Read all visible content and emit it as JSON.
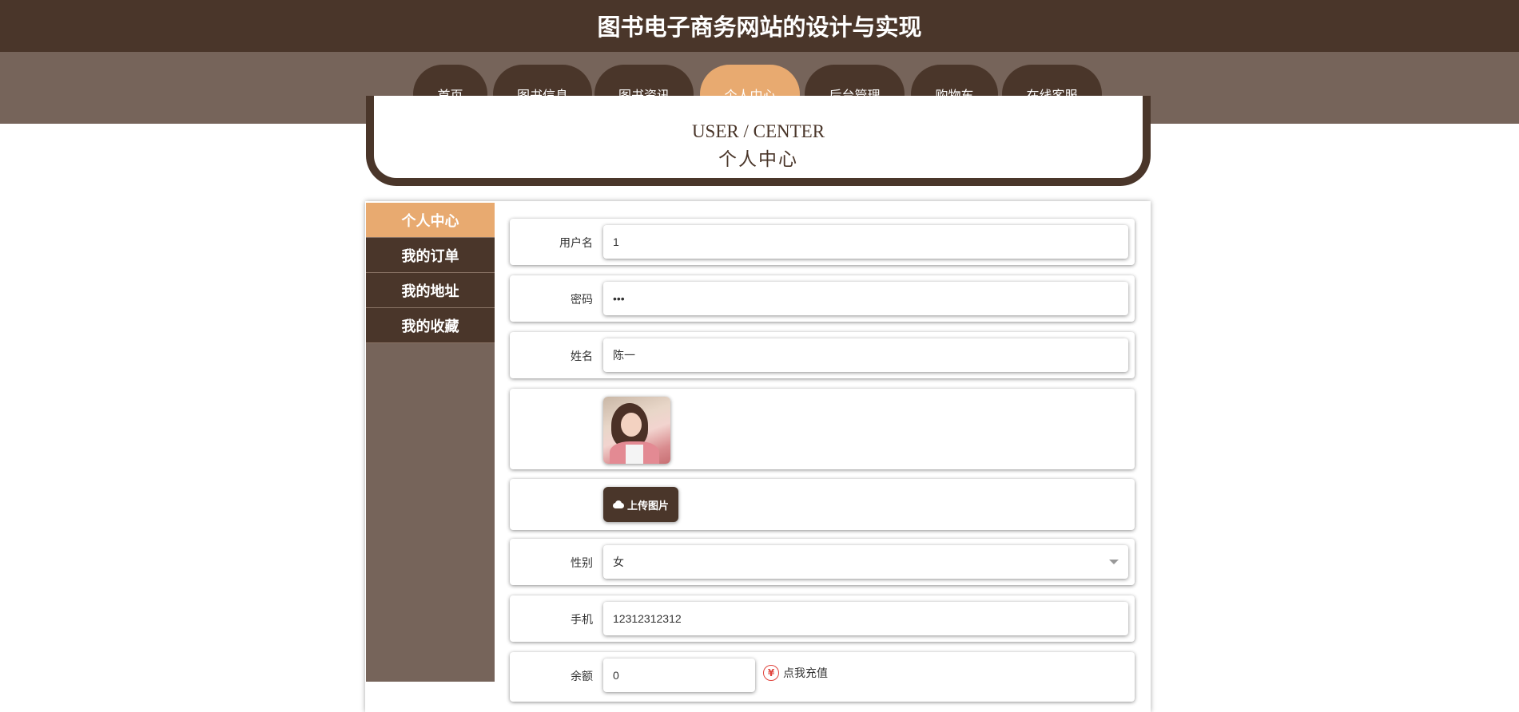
{
  "header": {
    "site_title": "图书电子商务网站的设计与实现"
  },
  "nav": {
    "items": [
      {
        "label": "首页"
      },
      {
        "label": "图书信息"
      },
      {
        "label": "图书资讯"
      },
      {
        "label": "个人中心",
        "active": true
      },
      {
        "label": "后台管理"
      },
      {
        "label": "购物车"
      },
      {
        "label": "在线客服"
      }
    ]
  },
  "banner": {
    "title_en": "USER / CENTER",
    "title_zh": "个人中心"
  },
  "sidebar": {
    "items": [
      {
        "label": "个人中心",
        "active": true
      },
      {
        "label": "我的订单"
      },
      {
        "label": "我的地址"
      },
      {
        "label": "我的收藏"
      }
    ]
  },
  "form": {
    "username": {
      "label": "用户名",
      "value": "1"
    },
    "password": {
      "label": "密码",
      "value": "•••"
    },
    "name": {
      "label": "姓名",
      "value": "陈一"
    },
    "upload_label": "上传图片",
    "gender": {
      "label": "性别",
      "value": "女"
    },
    "phone": {
      "label": "手机",
      "value": "12312312312"
    },
    "balance": {
      "label": "余额",
      "value": "0"
    },
    "recharge_label": "点我充值"
  },
  "icons": {
    "upload": "cloud-upload-icon",
    "recharge": "yen-icon",
    "select": "chevron-down-icon"
  },
  "colors": {
    "primary_dark": "#4a362a",
    "nav_bg": "#76645a",
    "accent": "#e8aa70",
    "recharge_red": "#e0443d"
  }
}
